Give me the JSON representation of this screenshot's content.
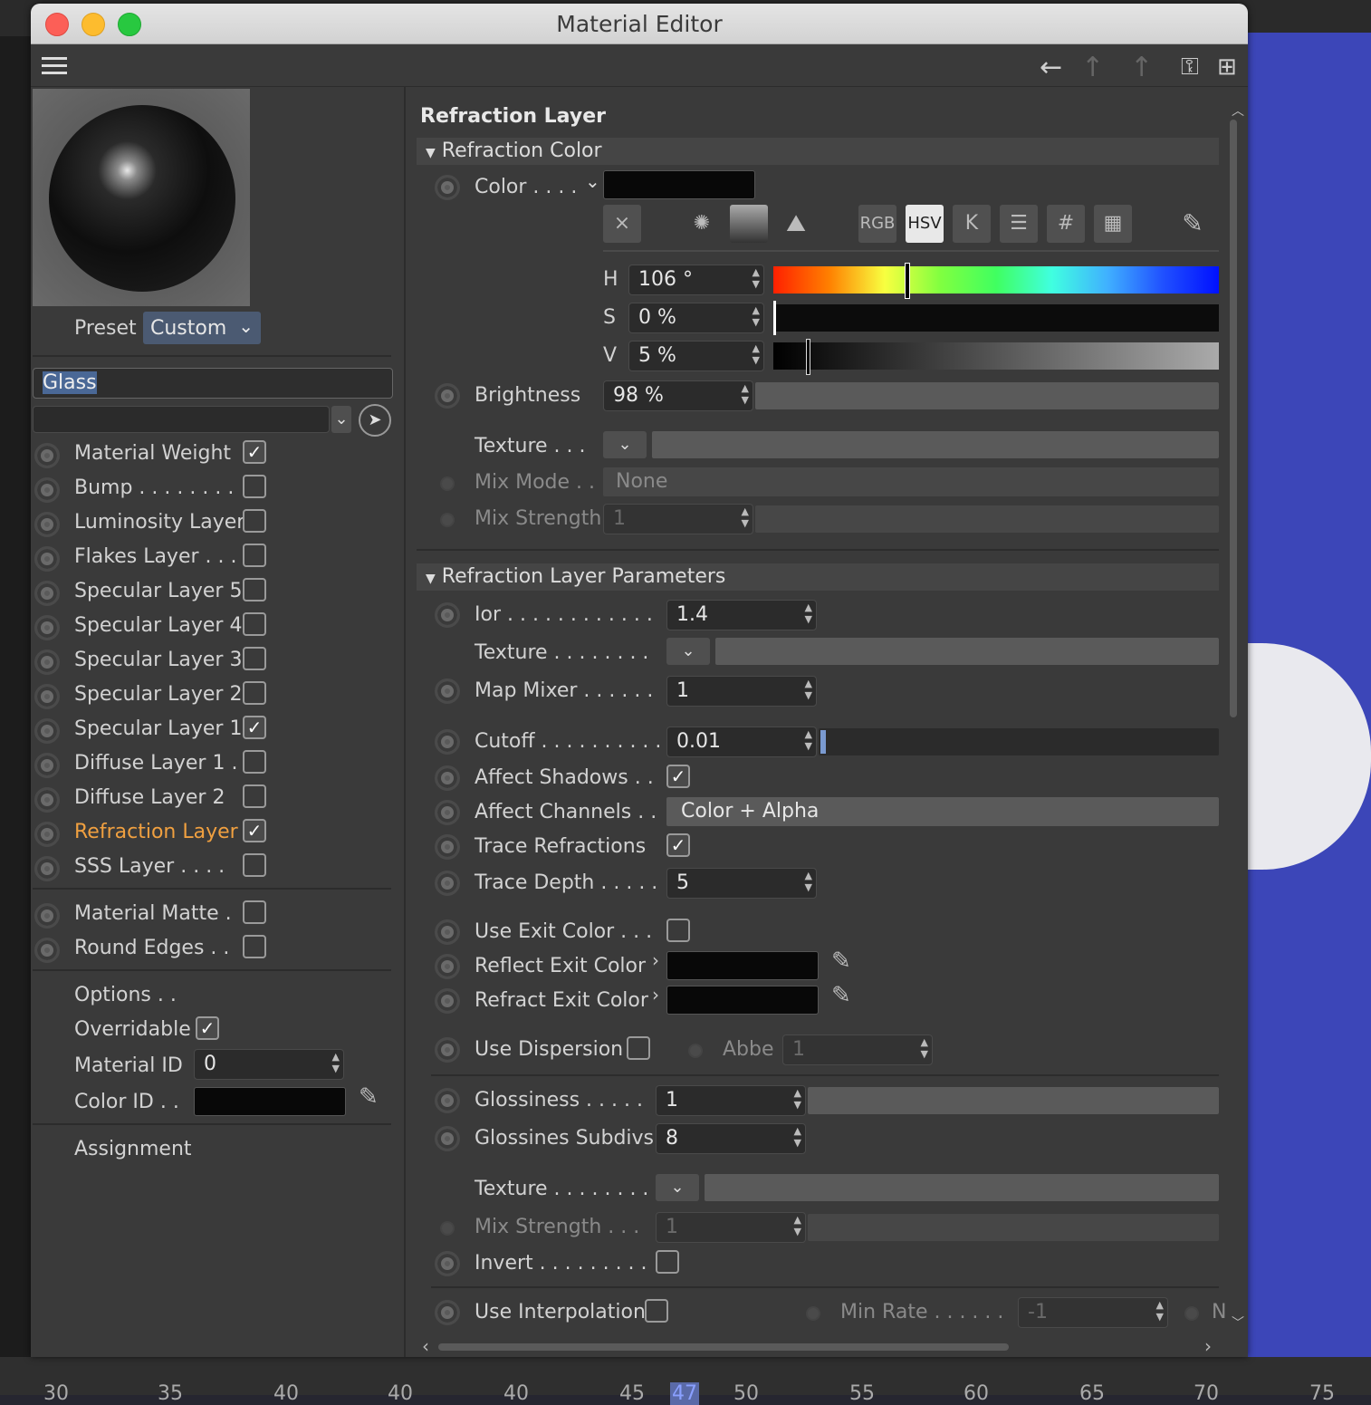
{
  "window": {
    "title": "Material Editor"
  },
  "ruler": {
    "ticks": [
      "30",
      "35",
      "40",
      "45",
      "47",
      "50",
      "55",
      "60",
      "65",
      "70",
      "75"
    ]
  },
  "left": {
    "preset_label": "Preset",
    "preset_value": "Custom",
    "name_value": "Glass",
    "channels": [
      {
        "label": "Material Weight",
        "checked": true
      },
      {
        "label": "Bump . . . . . . . .",
        "checked": false
      },
      {
        "label": "Luminosity Layer",
        "checked": false
      },
      {
        "label": "Flakes Layer . . .",
        "checked": false
      },
      {
        "label": "Specular Layer 5",
        "checked": false
      },
      {
        "label": "Specular Layer 4",
        "checked": false
      },
      {
        "label": "Specular Layer 3",
        "checked": false
      },
      {
        "label": "Specular Layer 2",
        "checked": false
      },
      {
        "label": "Specular Layer 1",
        "checked": true
      },
      {
        "label": "Diffuse Layer 1 .",
        "checked": false
      },
      {
        "label": "Diffuse Layer 2",
        "checked": false
      },
      {
        "label": "Refraction Layer",
        "checked": true,
        "active": true
      },
      {
        "label": "SSS Layer . . . .",
        "checked": false
      }
    ],
    "extras": [
      {
        "label": "Material Matte .",
        "checked": false
      },
      {
        "label": "Round Edges . .",
        "checked": false
      }
    ],
    "options_label": "Options . .",
    "overridable_label": "Overridable",
    "material_id_label": "Material ID",
    "material_id_value": "0",
    "color_id_label": "Color ID . .",
    "assignment_label": "Assignment"
  },
  "right": {
    "title": "Refraction Layer",
    "refraction_color_header": "Refraction Color",
    "color_label": "Color . . . .",
    "color_modes": [
      "RGB",
      "HSV",
      "K",
      "#"
    ],
    "h_label": "H",
    "h_value": "106 °",
    "h_fraction": 0.294,
    "s_label": "S",
    "s_value": "0 %",
    "v_label": "V",
    "v_value": "5 %",
    "brightness_label": "Brightness",
    "brightness_value": "98 %",
    "texture_label": "Texture . . .",
    "mix_mode_label": "Mix Mode . .",
    "mix_mode_value": "None",
    "mix_strength_label": "Mix Strength",
    "mix_strength_value": "1",
    "params_header": "Refraction Layer Parameters",
    "ior_label": "Ior . . . . . . . . . . . .",
    "ior_value": "1.4",
    "texture2_label": "Texture . . . . . . . .",
    "map_mixer_label": "Map Mixer . . . . . .",
    "map_mixer_value": "1",
    "cutoff_label": "Cutoff . . . . . . . . . .",
    "cutoff_value": "0.01",
    "affect_shadows_label": "Affect Shadows . .",
    "affect_channels_label": "Affect Channels . .",
    "affect_channels_value": "Color + Alpha",
    "trace_refractions_label": "Trace Refractions",
    "trace_depth_label": "Trace Depth . . . . .",
    "trace_depth_value": "5",
    "use_exit_color_label": "Use Exit Color . . .",
    "reflect_exit_label": "Reflect Exit Color",
    "refract_exit_label": "Refract Exit Color",
    "use_dispersion_label": "Use Dispersion",
    "abbe_label": "Abbe",
    "abbe_value": "1",
    "glossiness_label": "Glossiness . . . . .",
    "glossiness_value": "1",
    "gloss_subdivs_label": "Glossines Subdivs",
    "gloss_subdivs_value": "8",
    "texture3_label": "Texture . . . . . . . .",
    "mix_strength2_label": "Mix Strength . . .",
    "mix_strength2_value": "1",
    "invert_label": "Invert . . . . . . . . .",
    "use_interp_label": "Use Interpolation",
    "min_rate_label": "Min Rate . . . . . .",
    "min_rate_value": "-1",
    "n_label": "N"
  },
  "colors": {
    "accent_orange": "#f0a040",
    "bg_panel": "#3a3a3a",
    "viewport_blue": "#3c46b8"
  }
}
